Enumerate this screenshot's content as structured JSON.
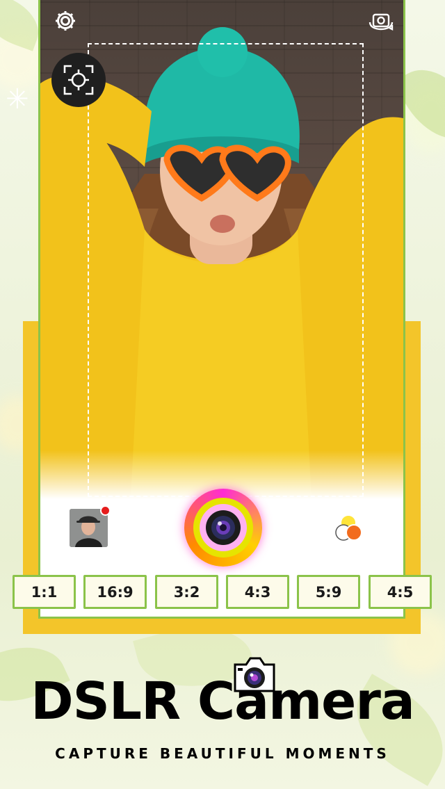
{
  "app": {
    "name": "DSLR Camera",
    "tagline": "CAPTURE BEAUTIFUL MOMENTS"
  },
  "top_bar": {
    "settings_icon": "gear-icon",
    "flip_icon": "camera-flip-icon"
  },
  "viewfinder": {
    "focus_icon": "focus-target-icon",
    "subject": "woman in teal knit beanie, orange heart sunglasses and yellow sweater"
  },
  "bottom_controls": {
    "gallery_icon": "gallery-thumbnail",
    "shutter_icon": "shutter-lens-icon",
    "filters_icon": "color-filters-icon",
    "gallery_has_new": true
  },
  "aspect_ratios": [
    "1:1",
    "16:9",
    "3:2",
    "4:3",
    "5:9",
    "4:5"
  ],
  "colors": {
    "frame_green": "#8bc34a",
    "band_yellow": "#f3c52a",
    "shutter_yellow": "#e6e400",
    "shutter_pink": "#ff2bd3",
    "badge_red": "#e51c1c"
  }
}
